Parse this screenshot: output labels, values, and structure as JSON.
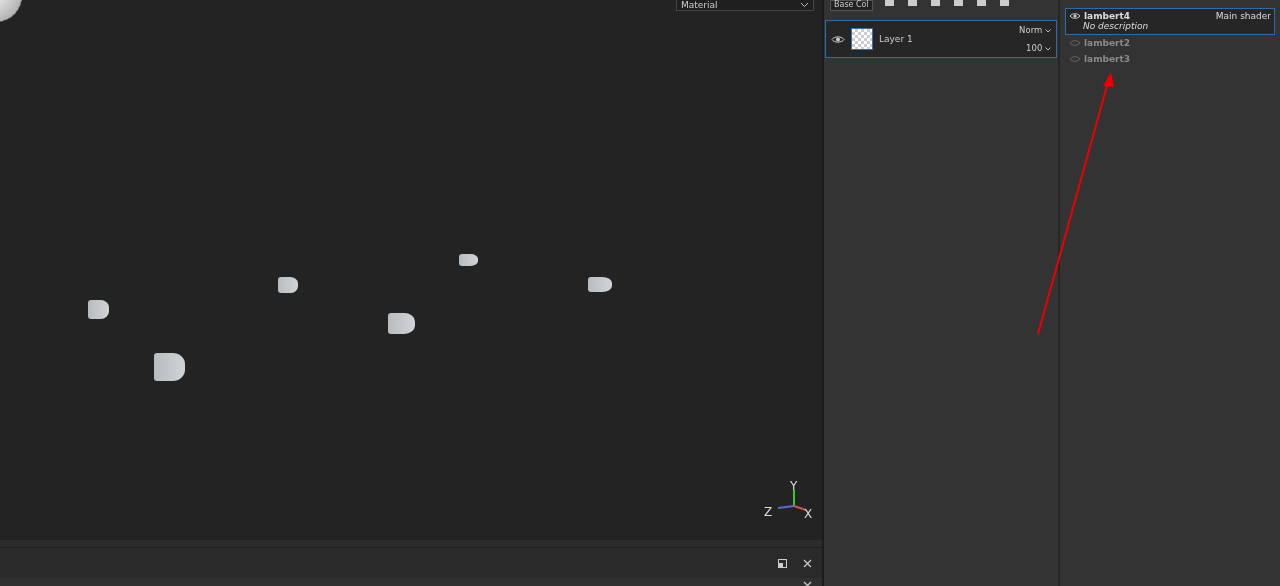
{
  "viewport": {
    "shading_dropdown": "Material",
    "axes": {
      "x": "X",
      "y": "Y",
      "z": "Z"
    }
  },
  "layers": {
    "channel_dropdown": "Base Col",
    "items": [
      {
        "name": "Layer 1",
        "visible": true,
        "selected": true,
        "blend": "Norm",
        "opacity": "100"
      }
    ]
  },
  "shaders": {
    "items": [
      {
        "name": "lambert4",
        "selected": true,
        "dimmed": false,
        "tag": "Main shader",
        "description": "No description"
      },
      {
        "name": "lambert2",
        "selected": false,
        "dimmed": true
      },
      {
        "name": "lambert3",
        "selected": false,
        "dimmed": true
      }
    ]
  }
}
